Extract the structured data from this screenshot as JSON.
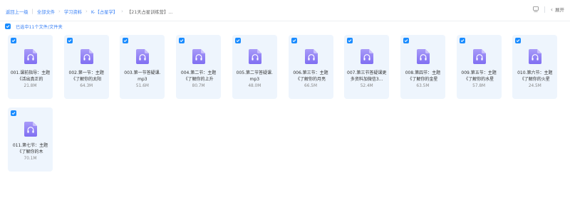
{
  "breadcrumb": {
    "back": "返回上一级",
    "all_files": "全部文件",
    "study": "学习资料",
    "folder": "K-【占星学】",
    "current": "【21天占星训练营】..."
  },
  "toolbar": {
    "collapse_label": "展开"
  },
  "selection": {
    "label": "已选中11个文件/文件夹"
  },
  "files": [
    {
      "name": "001.课前指导：主题《活出真正的",
      "size": "21.8M"
    },
    {
      "name": "002.第一节：主题《了解你的太阳",
      "size": "64.3M"
    },
    {
      "name": "003.第一节答疑课.mp3",
      "size": "51.6M"
    },
    {
      "name": "004.第二节：主题《了解你的上升",
      "size": "80.7M"
    },
    {
      "name": "005.第二节答疑课.mp3",
      "size": "48.0M"
    },
    {
      "name": "006.第三节：主题《了解你的月亮",
      "size": "66.5M"
    },
    {
      "name": "007.第三节答疑课更多资料加微信3...",
      "size": "52.4M"
    },
    {
      "name": "008.第四节：主题《了解你的金星",
      "size": "63.5M"
    },
    {
      "name": "009.第五节：主题《了解你的水星",
      "size": "57.8M"
    },
    {
      "name": "010.第六节：主题《了解你的火星",
      "size": "24.5M"
    },
    {
      "name": "011.第七节：主题《了解你的木",
      "size": "70.1M"
    }
  ],
  "colors": {
    "accent": "#1a8cff",
    "card_bg": "#eef5fd",
    "icon_purple": "#8b7cf6"
  }
}
